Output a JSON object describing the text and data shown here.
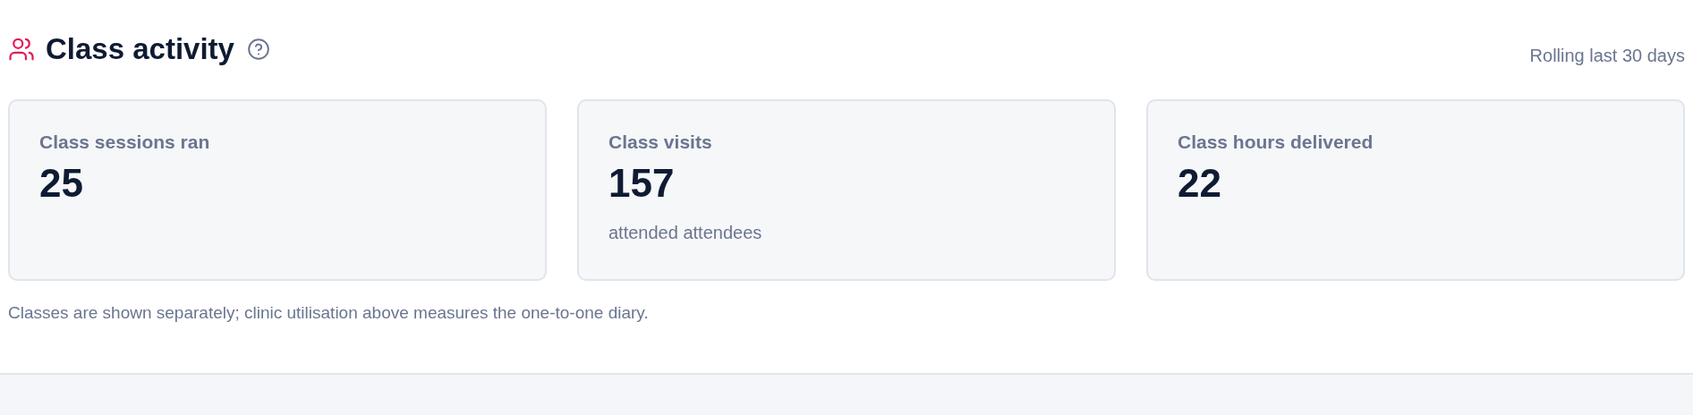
{
  "section": {
    "title": "Class activity",
    "period": "Rolling last 30 days"
  },
  "cards": [
    {
      "label": "Class sessions ran",
      "value": "25"
    },
    {
      "label": "Class visits",
      "value": "157",
      "caption": "attended attendees"
    },
    {
      "label": "Class hours delivered",
      "value": "22"
    }
  ],
  "footnote": "Classes are shown separately; clinic utilisation above measures the one-to-one diary."
}
